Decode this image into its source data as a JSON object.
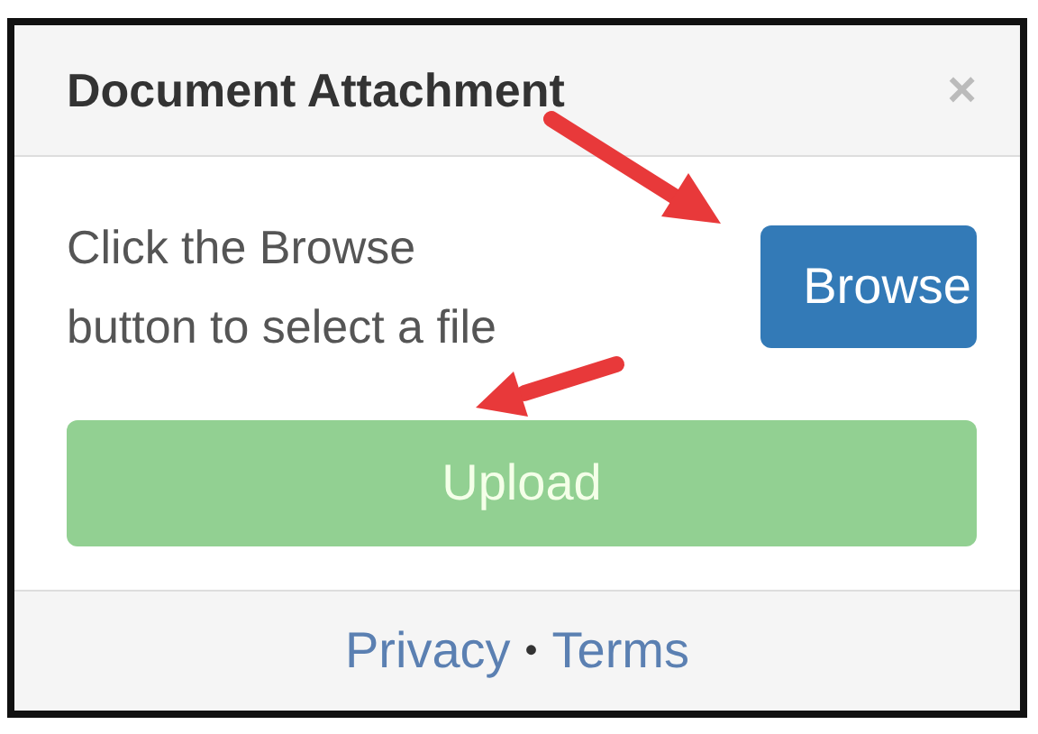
{
  "dialog": {
    "title": "Document Attachment",
    "close": "×"
  },
  "message": "Click the Browse button to select a file",
  "browse_button": {
    "label": "Browse"
  },
  "upload_button": {
    "label": "Upload",
    "disabled": true
  },
  "footer": {
    "links": [
      "Privacy",
      "Terms"
    ],
    "separator": "•"
  },
  "annotations": [
    {
      "kind": "arrow"
    },
    {
      "kind": "arrow"
    }
  ]
}
